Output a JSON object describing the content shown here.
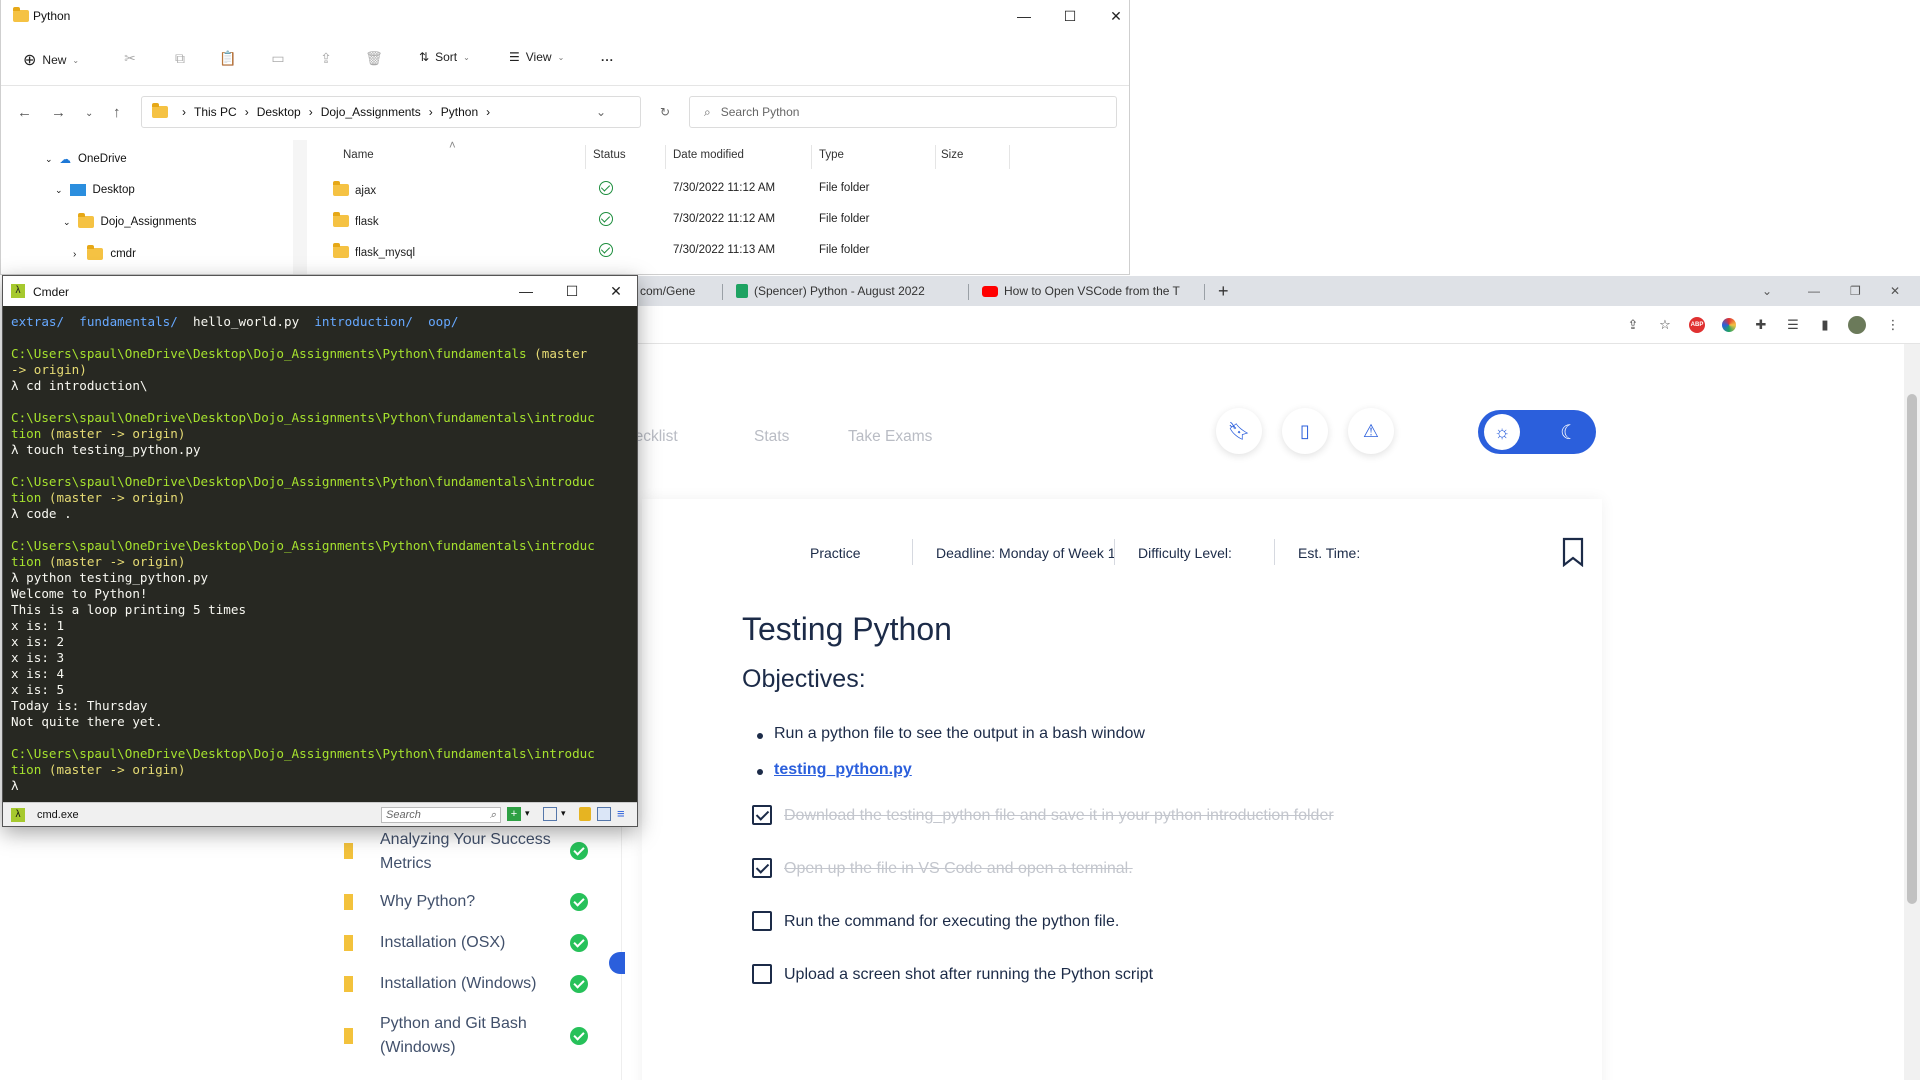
{
  "explorer": {
    "title": "Python",
    "toolbar": {
      "new": "New",
      "sort": "Sort",
      "view": "View",
      "more": "..."
    },
    "breadcrumb": [
      "This PC",
      "Desktop",
      "Dojo_Assignments",
      "Python"
    ],
    "search_placeholder": "Search Python",
    "nav": [
      {
        "label": "OneDrive",
        "icon": "cloud-icon"
      },
      {
        "label": "Desktop",
        "icon": "desktop-icon"
      },
      {
        "label": "Dojo_Assignments",
        "icon": "folder-icon"
      },
      {
        "label": "cmdr",
        "icon": "folder-icon"
      }
    ],
    "columns": {
      "name": "Name",
      "status": "Status",
      "date": "Date modified",
      "type": "Type",
      "size": "Size"
    },
    "files": [
      {
        "name": "ajax",
        "date": "7/30/2022 11:12 AM",
        "type": "File folder"
      },
      {
        "name": "flask",
        "date": "7/30/2022 11:12 AM",
        "type": "File folder"
      },
      {
        "name": "flask_mysql",
        "date": "7/30/2022 11:13 AM",
        "type": "File folder"
      }
    ]
  },
  "chrome": {
    "tabs": [
      {
        "label": "com/Gene"
      },
      {
        "label": "(Spencer) Python - August 2022"
      },
      {
        "label": "How to Open VSCode from the T"
      }
    ],
    "new_tab": "+",
    "ext_abp": "ABP"
  },
  "page": {
    "nav": {
      "checklist": "hecklist",
      "stats": "Stats",
      "exams": "Take Exams"
    },
    "meta": {
      "practice": "Practice",
      "deadline": "Deadline: Monday of Week 1",
      "difficulty": "Difficulty Level:",
      "time": "Est. Time:"
    },
    "title": "Testing Python",
    "objectives_heading": "Objectives:",
    "objectives": [
      "Run a python file to see the output in a bash window",
      "testing_python.py"
    ],
    "checklist": [
      {
        "text": "Download the testing_python file and save it in your python introduction folder",
        "done": true
      },
      {
        "text": "Open up the file in VS Code and open a terminal.",
        "done": true
      },
      {
        "text": "Run the command for executing the python file.",
        "done": false
      },
      {
        "text": "Upload a screen shot after running the Python script",
        "done": false
      }
    ],
    "lessons": [
      "Analyzing Your Success Metrics",
      "Why Python?",
      "Installation (OSX)",
      "Installation (Windows)",
      "Python and Git Bash (Windows)"
    ]
  },
  "cmder": {
    "title": "Cmder",
    "tab": "cmd.exe",
    "search_placeholder": "Search",
    "ls": [
      "extras/",
      "fundamentals/",
      "hello_world.py",
      "introduction/",
      "oop/"
    ],
    "path1": "C:\\Users\\spaul\\OneDrive\\Desktop\\Dojo_Assignments\\Python\\fundamentals",
    "branch1": " (master",
    "branch1b": "-> origin)",
    "cmd1": "λ cd introduction\\",
    "path2": "C:\\Users\\spaul\\OneDrive\\Desktop\\Dojo_Assignments\\Python\\fundamentals\\introduc",
    "path2b": "tion",
    "branch": " (master -> origin)",
    "cmd2": "λ touch testing_python.py",
    "cmd3": "λ code .",
    "cmd4": "λ python testing_python.py",
    "output": [
      "Welcome to Python!",
      "This is a loop printing 5 times",
      "x is: 1",
      "x is: 2",
      "x is: 3",
      "x is: 4",
      "x is: 5",
      "Today is: Thursday",
      "Not quite there yet."
    ],
    "prompt": "λ"
  }
}
